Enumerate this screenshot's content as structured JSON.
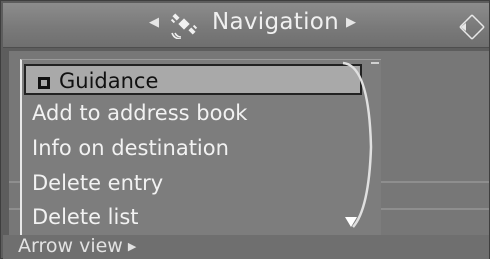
{
  "header": {
    "title": "Navigation",
    "left_arrow_icon": "left-triangle-icon",
    "right_arrow_icon": "right-triangle-icon",
    "nav_icon": "satellite-icon",
    "controller_icon": "controller-directions-icon"
  },
  "menu": {
    "items": [
      {
        "label": "Guidance",
        "selected": true
      },
      {
        "label": "Add to address book",
        "selected": false
      },
      {
        "label": "Info on destination",
        "selected": false
      },
      {
        "label": "Delete entry",
        "selected": false
      },
      {
        "label": "Delete list",
        "selected": false
      }
    ],
    "scroll_indicator_icon": "scroll-down-arrow-icon"
  },
  "bottom": {
    "arrow_view_label": "Arrow view"
  },
  "colors": {
    "selected_bg": "#a9a9a9",
    "menu_bg": "#7d7d7d",
    "screen_bg": "#5d5d5d"
  }
}
